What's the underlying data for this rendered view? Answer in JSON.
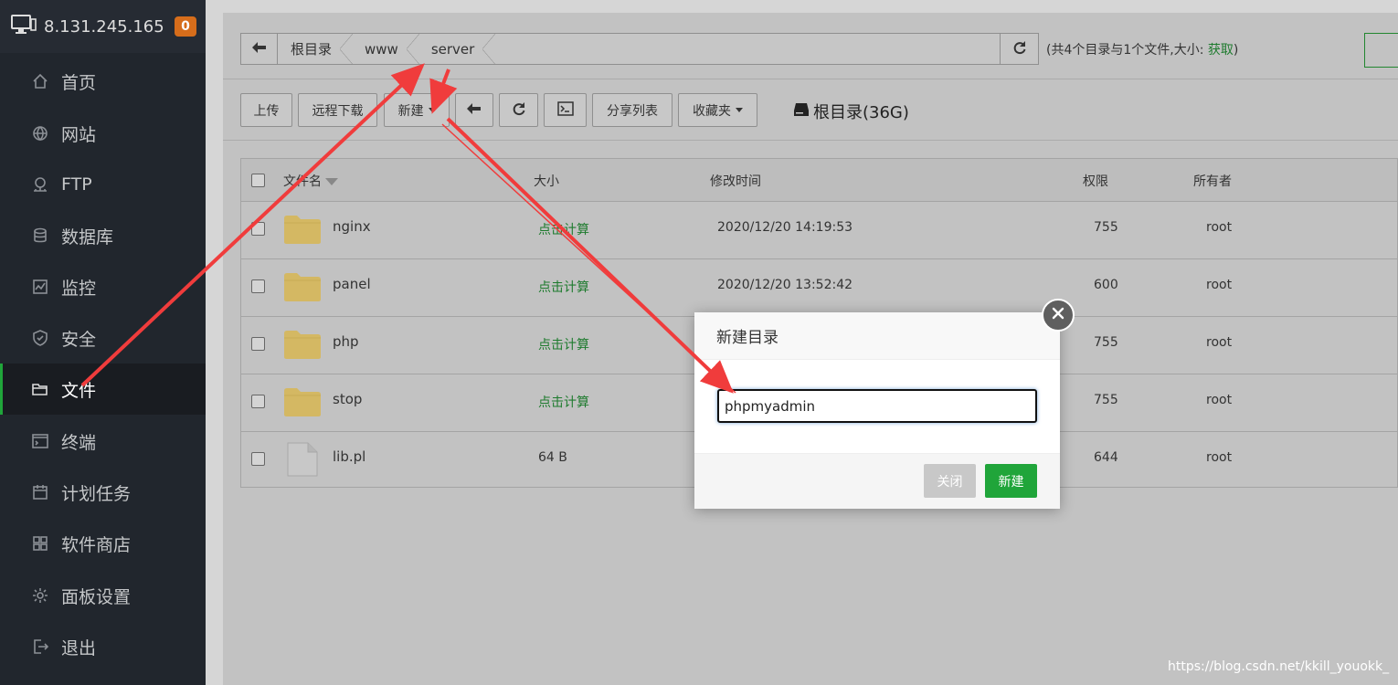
{
  "sidebar": {
    "ip": "8.131.245.165",
    "badge": "0",
    "items": [
      {
        "label": "首页",
        "icon": "home-icon"
      },
      {
        "label": "网站",
        "icon": "globe-icon"
      },
      {
        "label": "FTP",
        "icon": "ftp-icon"
      },
      {
        "label": "数据库",
        "icon": "database-icon"
      },
      {
        "label": "监控",
        "icon": "monitor-icon"
      },
      {
        "label": "安全",
        "icon": "shield-icon"
      },
      {
        "label": "文件",
        "icon": "folder-icon",
        "active": true
      },
      {
        "label": "终端",
        "icon": "terminal-icon"
      },
      {
        "label": "计划任务",
        "icon": "calendar-icon"
      },
      {
        "label": "软件商店",
        "icon": "apps-icon"
      },
      {
        "label": "面板设置",
        "icon": "gear-icon"
      },
      {
        "label": "退出",
        "icon": "logout-icon"
      }
    ]
  },
  "breadcrumb": {
    "items": [
      "根目录",
      "www",
      "server"
    ],
    "summary_prefix": "(共4个目录与1个文件,大小: ",
    "summary_link": "获取",
    "summary_suffix": ")"
  },
  "toolbar": {
    "upload": "上传",
    "remote_download": "远程下载",
    "new": "新建",
    "share_list": "分享列表",
    "favorites": "收藏夹",
    "disk": "根目录(36G)"
  },
  "table": {
    "headers": {
      "name": "文件名",
      "size": "大小",
      "mtime": "修改时间",
      "perm": "权限",
      "owner": "所有者"
    },
    "rows": [
      {
        "name": "nginx",
        "size": "点击计算",
        "mtime": "2020/12/20 14:19:53",
        "perm": "755",
        "owner": "root",
        "type": "folder"
      },
      {
        "name": "panel",
        "size": "点击计算",
        "mtime": "2020/12/20 13:52:42",
        "perm": "600",
        "owner": "root",
        "type": "folder"
      },
      {
        "name": "php",
        "size": "点击计算",
        "mtime": "",
        "perm": "755",
        "owner": "root",
        "type": "folder"
      },
      {
        "name": "stop",
        "size": "点击计算",
        "mtime": "",
        "perm": "755",
        "owner": "root",
        "type": "folder"
      },
      {
        "name": "lib.pl",
        "size": "64 B",
        "mtime": "",
        "perm": "644",
        "owner": "root",
        "type": "file"
      }
    ]
  },
  "dialog": {
    "title": "新建目录",
    "input_value": "phpmyadmin",
    "close_label": "关闭",
    "confirm_label": "新建"
  },
  "colors": {
    "accent": "#20a53a",
    "sidebar": "#21262d",
    "badge": "#d66d1b",
    "annotation": "#f03c3c"
  },
  "watermark": "https://blog.csdn.net/kkill_youokk_"
}
